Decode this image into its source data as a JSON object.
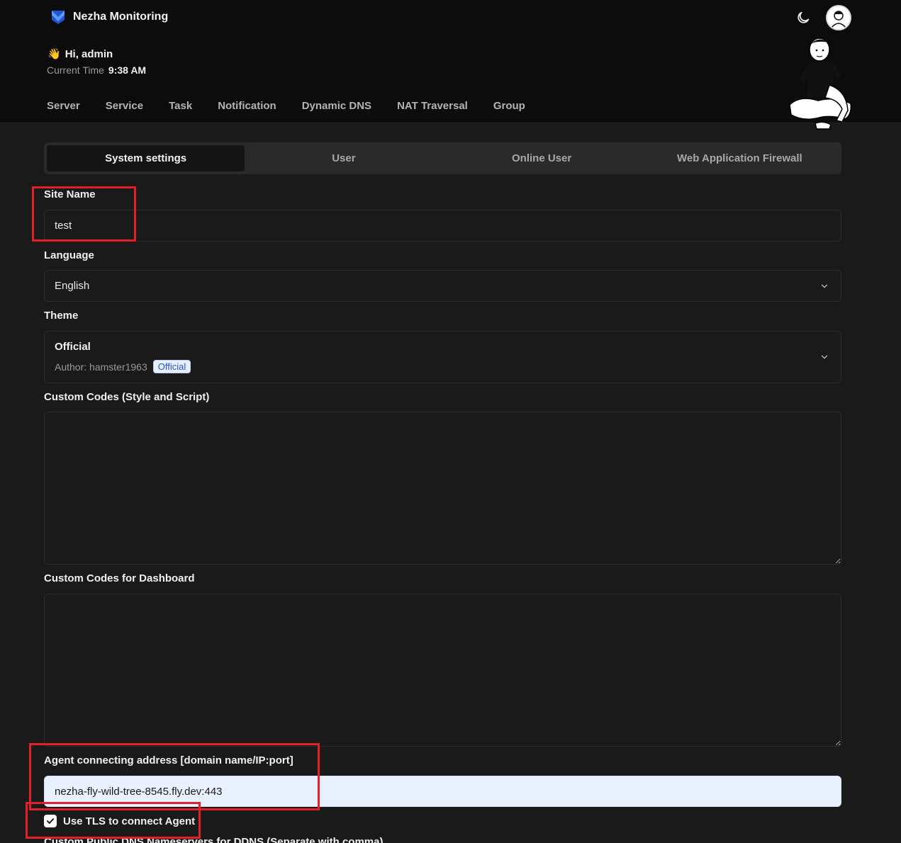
{
  "header": {
    "brand": "Nezha Monitoring",
    "greeting": "Hi, admin",
    "wave_emoji": "👋",
    "time_label": "Current Time",
    "time_value": "9:38 AM",
    "nav": [
      "Server",
      "Service",
      "Task",
      "Notification",
      "Dynamic DNS",
      "NAT Traversal",
      "Group"
    ],
    "theme_toggle_icon": "moon-icon",
    "avatar_icon": "user-avatar"
  },
  "tabs": [
    {
      "label": "System settings",
      "active": true
    },
    {
      "label": "User",
      "active": false
    },
    {
      "label": "Online User",
      "active": false
    },
    {
      "label": "Web Application Firewall",
      "active": false
    }
  ],
  "form": {
    "site_name": {
      "label": "Site Name",
      "value": "test"
    },
    "language": {
      "label": "Language",
      "value": "English"
    },
    "theme": {
      "label": "Theme",
      "name": "Official",
      "author": "Author: hamster1963",
      "badge": "Official"
    },
    "custom_codes": {
      "label": "Custom Codes (Style and Script)",
      "value": ""
    },
    "dashboard_codes": {
      "label": "Custom Codes for Dashboard",
      "value": ""
    },
    "agent_address": {
      "label": "Agent connecting address [domain name/IP:port]",
      "value": "nezha-fly-wild-tree-8545.fly.dev:443"
    },
    "tls": {
      "label": "Use TLS to connect Agent",
      "checked": true
    },
    "dns_cutoff_label": "Custom Public DNS Nameservers for DDNS (Separate with comma)"
  },
  "colors": {
    "background": "#1a1a1a",
    "header_bg": "#0c0c0c",
    "brand_blue": "#2f6bff",
    "annotation_red": "#e0212b",
    "badge_blue": "#2b55c8"
  }
}
